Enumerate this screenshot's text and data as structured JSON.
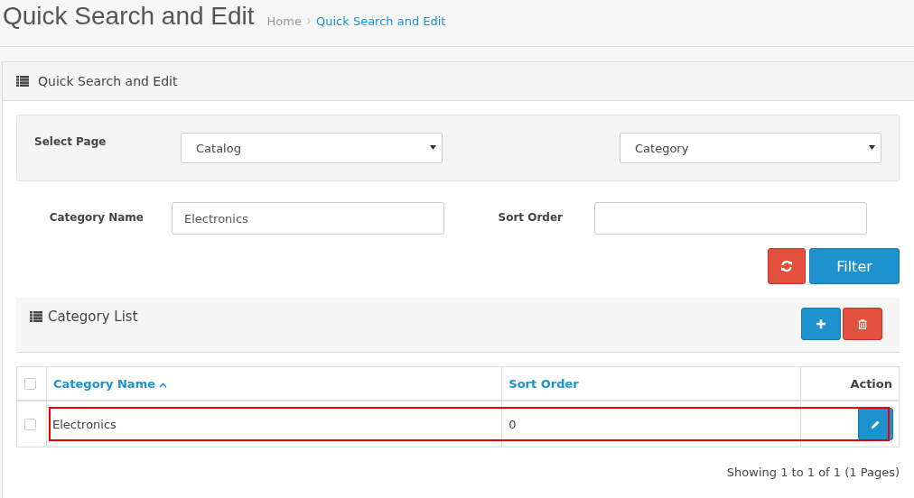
{
  "page_title": "Quick Search and Edit",
  "breadcrumbs": [
    {
      "label": "Home",
      "selected": false
    },
    {
      "label": "Quick Search and Edit",
      "selected": true
    }
  ],
  "panel": {
    "title": "Quick Search and Edit"
  },
  "select_page": {
    "label": "Select Page",
    "selects": [
      {
        "value": "Catalog"
      },
      {
        "value": "Category"
      }
    ]
  },
  "filters": [
    {
      "label": "Category Name",
      "value": "Electronics"
    },
    {
      "label": "Sort Order"
    }
  ],
  "filter_button": "Filter",
  "list": {
    "title": "Category List",
    "select_all_checked": false,
    "columns": [
      {
        "label": "Category Name",
        "sorted": true
      },
      {
        "label": "Sort Order",
        "sorted": false
      },
      {
        "label": "Action",
        "sorted": false
      }
    ],
    "rows": [
      {
        "checked": false,
        "highlighted": true,
        "cells": [
          "Electronics",
          "0"
        ]
      }
    ],
    "pagination": "Showing 1 to 1 of 1 (1 Pages)"
  }
}
